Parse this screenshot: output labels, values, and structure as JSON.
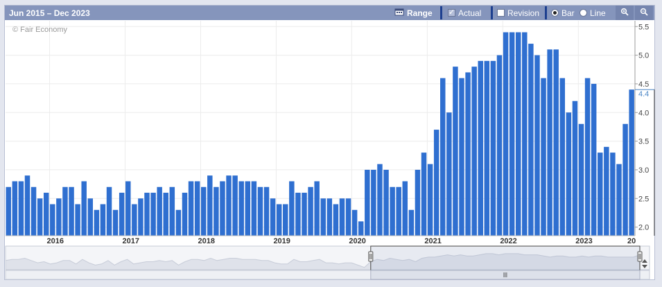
{
  "toolbar": {
    "date_range": "Jun 2015 – Dec 2023",
    "range_label": "Range",
    "actual_label": "Actual",
    "revision_label": "Revision",
    "bar_label": "Bar",
    "line_label": "Line",
    "actual_checked": true,
    "revision_checked": false,
    "selected_type": "Bar",
    "icons": [
      "calendar-icon",
      "zoom-in-icon",
      "zoom-out-icon"
    ]
  },
  "watermark": "© Fair Economy",
  "colors": {
    "bar": "#2f6fd0",
    "toolbar": "#8595bc",
    "accent": "#1d3f8f",
    "current_value": "#4a86c6"
  },
  "chart_data": {
    "type": "bar",
    "start": "2015-06",
    "values": [
      2.7,
      2.8,
      2.8,
      2.9,
      2.7,
      2.5,
      2.6,
      2.4,
      2.5,
      2.7,
      2.7,
      2.4,
      2.8,
      2.5,
      2.3,
      2.4,
      2.7,
      2.3,
      2.6,
      2.8,
      2.4,
      2.5,
      2.6,
      2.6,
      2.7,
      2.6,
      2.7,
      2.3,
      2.6,
      2.8,
      2.8,
      2.7,
      2.9,
      2.7,
      2.8,
      2.9,
      2.9,
      2.8,
      2.8,
      2.8,
      2.7,
      2.7,
      2.5,
      2.4,
      2.4,
      2.8,
      2.6,
      2.6,
      2.7,
      2.8,
      2.5,
      2.5,
      2.4,
      2.5,
      2.5,
      2.3,
      2.1,
      3.0,
      3.0,
      3.1,
      3.0,
      2.7,
      2.7,
      2.8,
      2.3,
      3.0,
      3.3,
      3.1,
      3.7,
      4.6,
      4.0,
      4.8,
      4.6,
      4.7,
      4.8,
      4.9,
      4.9,
      4.9,
      5.0,
      5.4,
      5.4,
      5.4,
      5.4,
      5.2,
      5.0,
      4.6,
      5.1,
      5.1,
      4.6,
      4.0,
      4.2,
      3.8,
      4.6,
      4.5,
      3.3,
      3.4,
      3.3,
      3.1,
      3.8,
      4.4
    ],
    "x_tick_labels": [
      "2016",
      "2017",
      "2018",
      "2019",
      "2020",
      "2021",
      "2022",
      "2023",
      "20"
    ],
    "y_tick_labels": [
      "2.0",
      "2.5",
      "3.0",
      "3.5",
      "4.0",
      "4.5",
      "5.0",
      "5.5"
    ],
    "ylim": [
      1.85,
      5.6
    ],
    "current_value_label": "4.4",
    "grid": true
  },
  "navigator": {
    "series": [
      2.7,
      2.8,
      2.8,
      2.9,
      2.7,
      2.5,
      2.6,
      2.4,
      2.5,
      2.7,
      2.7,
      2.4,
      2.8,
      2.5,
      2.3,
      2.4,
      2.7,
      2.3,
      2.6,
      2.8,
      2.4,
      2.5,
      2.6,
      2.6,
      2.7,
      2.6,
      2.7,
      2.3,
      2.6,
      2.8,
      2.8,
      2.7,
      2.9,
      2.7,
      2.8,
      2.9,
      2.9,
      2.8,
      2.8,
      2.8,
      2.7,
      2.7,
      2.5,
      2.4,
      2.4,
      2.8,
      2.6,
      2.6,
      2.7,
      2.8,
      2.5,
      2.5,
      2.4,
      2.5,
      2.5,
      2.3,
      2.1,
      2.6,
      2.8,
      2.7,
      2.9,
      2.8,
      2.7,
      2.8,
      2.6,
      2.9,
      3.0,
      3.0,
      3.1,
      3.2,
      3.1,
      3.2,
      3.1,
      3.1,
      3.2,
      3.3,
      3.3,
      3.2,
      3.3,
      3.3,
      3.3,
      3.2,
      3.2,
      3.2,
      3.1,
      3.0,
      3.1,
      3.1,
      3.0,
      3.0,
      3.1,
      3.0,
      3.1,
      3.1,
      3.0,
      3.0,
      3.0,
      3.0,
      3.0,
      3.2
    ],
    "handle_icon": "grip-handle-icon",
    "scroll_icon": "up-down-arrows-icon",
    "selection_from_index": 57
  }
}
